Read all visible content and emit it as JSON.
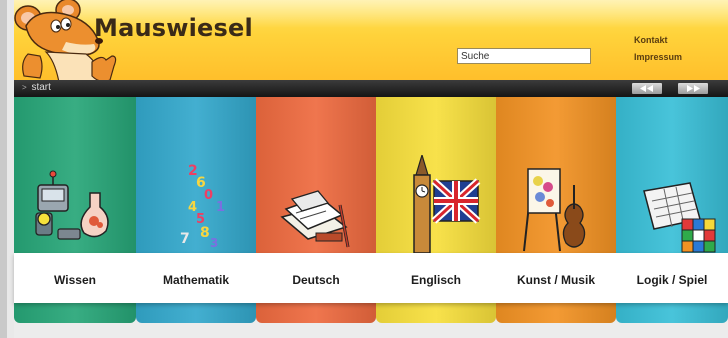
{
  "header": {
    "logo_text": "Mauswiesel",
    "search_placeholder": "Suche",
    "links": {
      "kontakt": "Kontakt",
      "impressum": "Impressum"
    }
  },
  "nav": {
    "breadcrumb_prefix": ">",
    "breadcrumb": "start",
    "prev_icon": "double-arrow-left-icon",
    "next_icon": "double-arrow-right-icon"
  },
  "categories": [
    {
      "label": "Wissen",
      "color": "#27a678",
      "icon": "science-robot-icon"
    },
    {
      "label": "Mathematik",
      "color": "#33a8cc",
      "icon": "numbers-icon"
    },
    {
      "label": "Deutsch",
      "color": "#ee6a3f",
      "icon": "books-pen-icon"
    },
    {
      "label": "Englisch",
      "color": "#f7df3c",
      "icon": "big-ben-flag-icon"
    },
    {
      "label": "Kunst / Musik",
      "color": "#f29223",
      "icon": "easel-violin-icon"
    },
    {
      "label": "Logik / Spiel",
      "color": "#39bfd7",
      "icon": "calendar-cube-icon"
    }
  ],
  "colors": {
    "header": "#ffd23a",
    "navbar": "#242424",
    "label_strip": "#ffffff"
  }
}
